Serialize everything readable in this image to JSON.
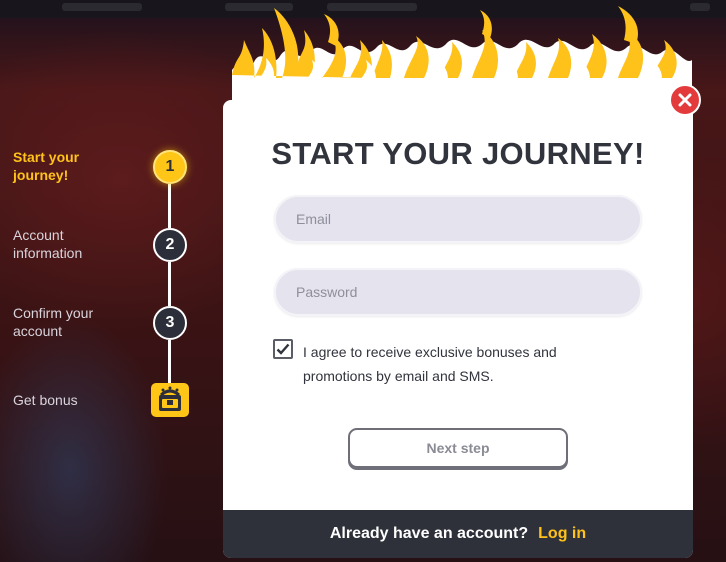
{
  "steps": [
    {
      "label": "Start your journey!",
      "number": "1",
      "active": true
    },
    {
      "label": "Account information",
      "number": "2",
      "active": false
    },
    {
      "label": "Confirm your account",
      "number": "3",
      "active": false
    },
    {
      "label": "Get bonus",
      "icon": "treasure-chest-icon",
      "active": false
    }
  ],
  "modal": {
    "title": "START YOUR JOURNEY!",
    "email_placeholder": "Email",
    "email_value": "",
    "password_placeholder": "Password",
    "password_value": "",
    "agree_checked": true,
    "agree_text": "I agree to receive exclusive bonuses and promotions by email and SMS.",
    "next_button": "Next step",
    "footer_text": "Already have an account?",
    "footer_link": "Log in",
    "close_icon": "close-icon"
  },
  "colors": {
    "accent": "#ffc21a",
    "close": "#e33b3b",
    "footer_bg": "#2f313a",
    "field_bg": "#e4e3ee",
    "title": "#32343d"
  }
}
